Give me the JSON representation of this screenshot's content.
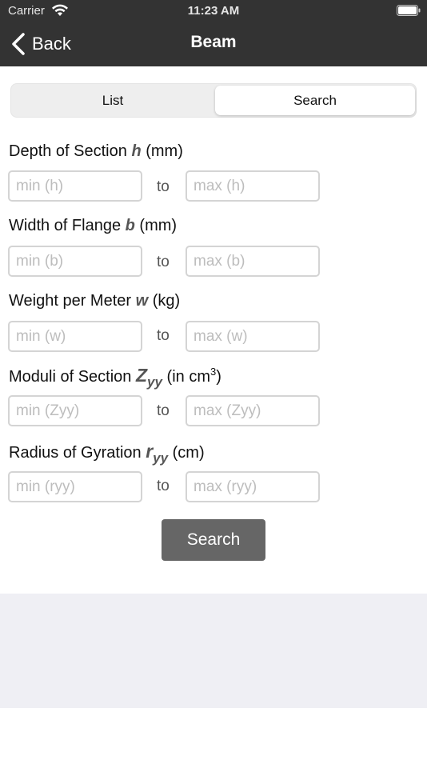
{
  "status_bar": {
    "carrier": "Carrier",
    "time": "11:23 AM"
  },
  "nav": {
    "back_label": "Back",
    "title": "Beam"
  },
  "segments": {
    "list": "List",
    "search": "Search",
    "selected": "Search"
  },
  "fields": {
    "depth": {
      "label_pre": "Depth of Section",
      "symbol": "h",
      "label_post": "(mm)",
      "min_placeholder": "min (h)",
      "max_placeholder": "max (h)"
    },
    "width": {
      "label_pre": "Width of Flange",
      "symbol": "b",
      "label_post": "(mm)",
      "min_placeholder": "min (b)",
      "max_placeholder": "max (b)"
    },
    "weight": {
      "label_pre": "Weight per Meter",
      "symbol": "w",
      "label_post": "(kg)",
      "min_placeholder": "min (w)",
      "max_placeholder": "max (w)"
    },
    "moduli": {
      "label_pre": "Moduli of Section",
      "symbol": "Z",
      "subscript": "yy",
      "label_post": "(in cm",
      "superscript": "3",
      "label_close": ")",
      "min_placeholder": "min (Zyy)",
      "max_placeholder": "max (Zyy)"
    },
    "radius": {
      "label_pre": "Radius of Gyration",
      "symbol": "r",
      "subscript": "yy",
      "label_post": "(cm)",
      "min_placeholder": "min (ryy)",
      "max_placeholder": "max (ryy)"
    }
  },
  "to_label": "to",
  "search_button": "Search",
  "colors": {
    "nav_bg": "#333333",
    "button_bg": "#666666",
    "input_border": "#d4d4d4",
    "bottom_panel": "#efeff4"
  }
}
